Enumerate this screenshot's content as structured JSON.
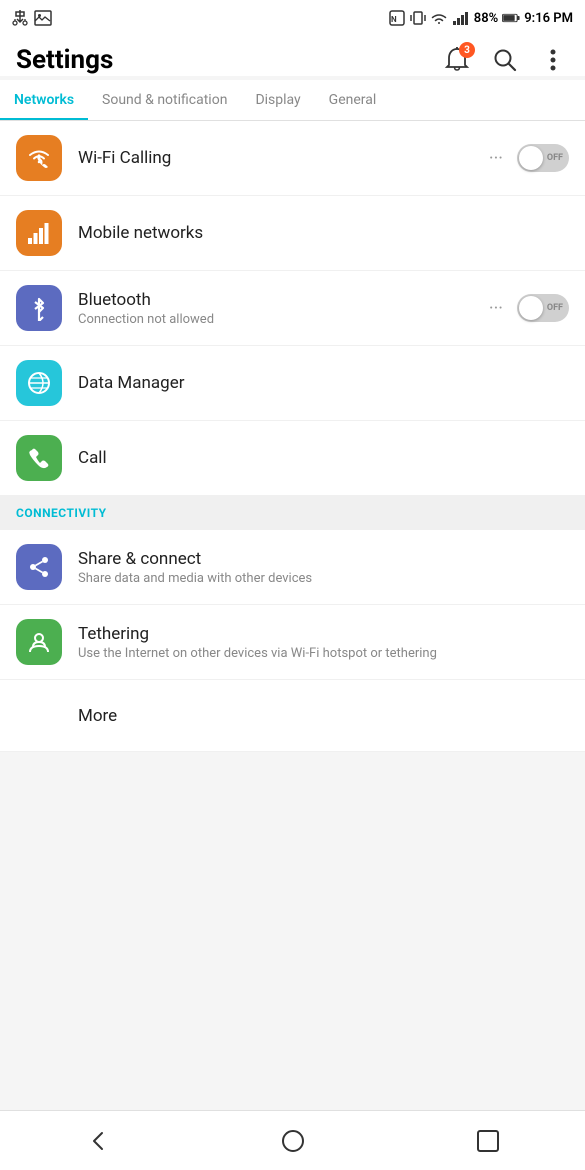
{
  "statusBar": {
    "leftIcons": [
      "usb",
      "image"
    ],
    "rightIcons": [
      "nfc",
      "vibrate",
      "wifi",
      "signal"
    ],
    "battery": "88%",
    "time": "9:16 PM",
    "batteryIcon": "🔋"
  },
  "header": {
    "title": "Settings",
    "notificationCount": "3"
  },
  "tabs": [
    {
      "label": "Networks",
      "active": true
    },
    {
      "label": "Sound & notification",
      "active": false
    },
    {
      "label": "Display",
      "active": false
    },
    {
      "label": "General",
      "active": false
    }
  ],
  "networkItems": [
    {
      "id": "wifi-calling",
      "title": "Wi-Fi Calling",
      "subtitle": "",
      "hasToggle": true,
      "toggleState": "off",
      "hasMenu": true,
      "iconColor": "wifi"
    },
    {
      "id": "mobile-networks",
      "title": "Mobile networks",
      "subtitle": "",
      "hasToggle": false,
      "hasMenu": false,
      "iconColor": "mobile"
    },
    {
      "id": "bluetooth",
      "title": "Bluetooth",
      "subtitle": "Connection not allowed",
      "hasToggle": true,
      "toggleState": "off",
      "hasMenu": true,
      "iconColor": "bt"
    },
    {
      "id": "data-manager",
      "title": "Data Manager",
      "subtitle": "",
      "hasToggle": false,
      "hasMenu": false,
      "iconColor": "data"
    },
    {
      "id": "call",
      "title": "Call",
      "subtitle": "",
      "hasToggle": false,
      "hasMenu": false,
      "iconColor": "call"
    }
  ],
  "connectivitySection": {
    "header": "CONNECTIVITY",
    "items": [
      {
        "id": "share-connect",
        "title": "Share & connect",
        "subtitle": "Share data and media with other devices",
        "iconColor": "share"
      },
      {
        "id": "tethering",
        "title": "Tethering",
        "subtitle": "Use the Internet on other devices via Wi-Fi hotspot or tethering",
        "iconColor": "tether"
      },
      {
        "id": "more",
        "title": "More",
        "subtitle": "",
        "iconColor": ""
      }
    ]
  },
  "bottomNav": {
    "back": "◁",
    "home": "○",
    "recent": "□"
  }
}
